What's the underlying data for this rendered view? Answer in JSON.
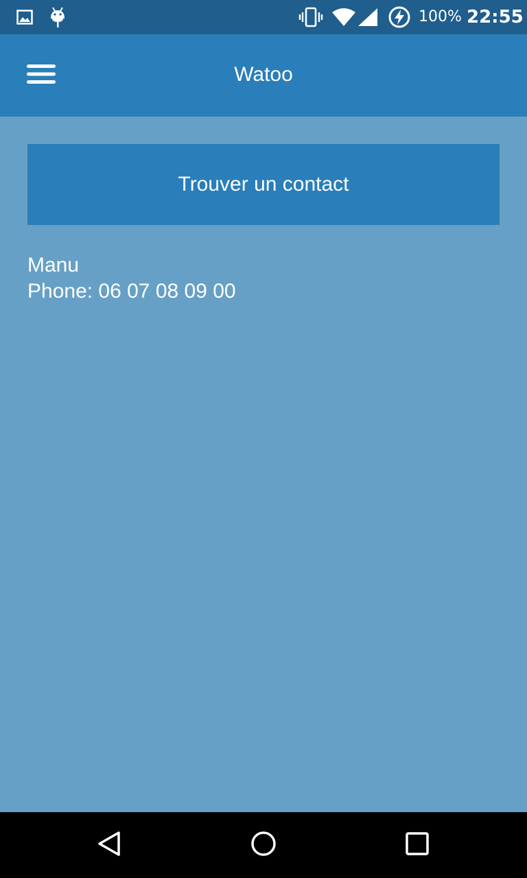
{
  "status_bar": {
    "left_icons": [
      "image-icon",
      "android-icon"
    ],
    "right_icons": [
      "vibrate-icon",
      "wifi-icon",
      "signal-icon",
      "battery-charging-icon"
    ],
    "battery_percent": "100%",
    "time": "22:55"
  },
  "app_bar": {
    "title": "Watoo",
    "menu_icon": "hamburger-menu-icon"
  },
  "main": {
    "find_button_label": "Trouver un contact",
    "contact": {
      "name": "Manu",
      "phone": "Phone: 06 07 08 09 00"
    }
  },
  "nav_bar": {
    "buttons": [
      "back-icon",
      "home-icon",
      "recents-icon"
    ]
  },
  "colors": {
    "status_bar": "#1f5e8d",
    "app_bar": "#2a7eb9",
    "background": "#67a0c6",
    "text": "#ffffff"
  }
}
